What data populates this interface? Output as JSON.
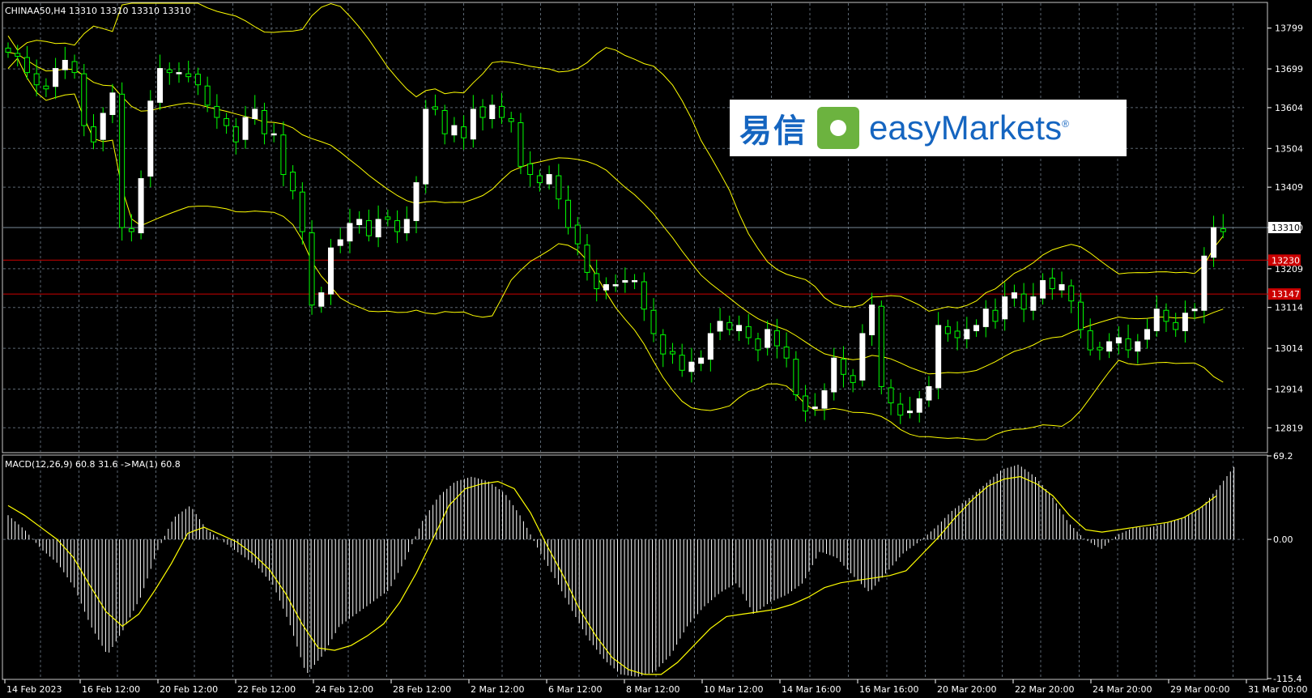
{
  "chart_data": [
    {
      "type": "candlestick",
      "title": "CHINAA50,H4  13310 13310 13310 13310",
      "ylim": [
        12760,
        13860
      ],
      "y_ticks": [
        13799,
        13699,
        13604,
        13504,
        13409,
        13310,
        13209,
        13114,
        13014,
        12914,
        12819
      ],
      "price_tags": [
        {
          "value": 13310,
          "label": "13310",
          "line_color": "#7a8a99",
          "tag_bg": "#ffffff",
          "tag_fg": "#000000"
        },
        {
          "value": 13230,
          "label": "13230",
          "line_color": "#cc0000",
          "tag_bg": "#cc0000",
          "tag_fg": "#ffffff"
        },
        {
          "value": 13147,
          "label": "13147",
          "line_color": "#cc0000",
          "tag_bg": "#cc0000",
          "tag_fg": "#ffffff"
        }
      ],
      "indicators": [
        "Bollinger Bands"
      ],
      "series": [
        {
          "name": "close",
          "values": [
            13740,
            13730,
            13690,
            13660,
            13650,
            13700,
            13720,
            13690,
            13560,
            13520,
            13590,
            13640,
            13310,
            13300,
            13430,
            13620,
            13700,
            13690,
            13690,
            13680,
            13660,
            13610,
            13580,
            13560,
            13520,
            13580,
            13600,
            13540,
            13540,
            13440,
            13400,
            13300,
            13120,
            13150,
            13260,
            13280,
            13320,
            13330,
            13290,
            13330,
            13330,
            13300,
            13330,
            13420,
            13600,
            13600,
            13540,
            13560,
            13530,
            13600,
            13580,
            13610,
            13580,
            13570,
            13460,
            13440,
            13420,
            13440,
            13380,
            13310,
            13270,
            13200,
            13160,
            13170,
            13170,
            13180,
            13180,
            13110,
            13050,
            13000,
            13000,
            12960,
            12980,
            12990,
            13050,
            13080,
            13060,
            13070,
            13040,
            13010,
            13060,
            13020,
            12990,
            12900,
            12860,
            12870,
            12910,
            12990,
            12950,
            12930,
            13050,
            13120,
            12920,
            12880,
            12850,
            12860,
            12890,
            12920,
            13070,
            13050,
            13040,
            13060,
            13070,
            13110,
            13080,
            13140,
            13150,
            13110,
            13140,
            13180,
            13160,
            13170,
            13130,
            13060,
            13010,
            13010,
            13030,
            13040,
            13010,
            13030,
            13060,
            13110,
            13080,
            13060,
            13100,
            13110,
            13240,
            13310,
            13300
          ],
          "color_up": "#ffffff",
          "color_down": "#00ff00"
        },
        {
          "name": "Bollinger Upper",
          "color": "#ffff00"
        },
        {
          "name": "Bollinger Middle",
          "color": "#ffff00"
        },
        {
          "name": "Bollinger Lower",
          "color": "#ffff00"
        }
      ]
    },
    {
      "type": "bar+line",
      "title": "MACD(12,26,9) 60.8 31.6  ->MA(1) 60.8",
      "ylim": [
        -115.4,
        69.2
      ],
      "y_ticks": [
        69.2,
        0.0,
        -115.4
      ],
      "y_tick_labels": [
        "69.2",
        "0.00",
        "-115.4"
      ],
      "series": [
        {
          "name": "MACD",
          "color": "#ffffff",
          "values": [
            20,
            8,
            -8,
            -20,
            -40,
            -72,
            -96,
            -74,
            -48,
            -10,
            18,
            28,
            8,
            -2,
            -12,
            -22,
            -38,
            -70,
            -112,
            -96,
            -72,
            -62,
            -52,
            -42,
            -16,
            15,
            36,
            48,
            52,
            48,
            38,
            18,
            -8,
            -32,
            -58,
            -82,
            -100,
            -112,
            -114,
            -110,
            -96,
            -72,
            -56,
            -44,
            -36,
            -62,
            -52,
            -46,
            -36,
            -10,
            -15,
            -30,
            -44,
            -28,
            -12,
            -2,
            10,
            24,
            34,
            46,
            58,
            62,
            52,
            36,
            14,
            0,
            -8,
            4,
            10,
            10,
            14,
            18,
            26,
            42,
            60
          ]
        },
        {
          "name": "Signal",
          "color": "#ffff00",
          "values": [
            28,
            20,
            10,
            0,
            -15,
            -38,
            -60,
            -72,
            -62,
            -42,
            -20,
            5,
            10,
            4,
            -2,
            -12,
            -25,
            -45,
            -70,
            -90,
            -92,
            -88,
            -80,
            -70,
            -52,
            -28,
            0,
            28,
            42,
            46,
            48,
            42,
            22,
            -5,
            -30,
            -58,
            -80,
            -98,
            -108,
            -112,
            -112,
            -102,
            -88,
            -74,
            -64,
            -62,
            -60,
            -58,
            -54,
            -48,
            -40,
            -36,
            -34,
            -32,
            -30,
            -26,
            -12,
            2,
            18,
            32,
            44,
            50,
            52,
            46,
            36,
            20,
            8,
            6,
            8,
            10,
            12,
            14,
            18,
            26,
            36
          ]
        }
      ]
    }
  ],
  "x_tick_labels": [
    "14 Feb 2023",
    "16 Feb 12:00",
    "20 Feb 12:00",
    "22 Feb 12:00",
    "24 Feb 12:00",
    "28 Feb 12:00",
    "2 Mar 12:00",
    "6 Mar 12:00",
    "8 Mar 12:00",
    "10 Mar 12:00",
    "14 Mar 16:00",
    "16 Mar 16:00",
    "20 Mar 20:00",
    "22 Mar 20:00",
    "24 Mar 20:00",
    "29 Mar 00:00",
    "31 Mar 00:00"
  ],
  "logo": {
    "cn": "易信",
    "en": "easyMarkets",
    "registered": "®"
  },
  "colors": {
    "background": "#000000",
    "grid": "#5a6570",
    "axis": "#ffffff",
    "bull": "#ffffff",
    "bear": "#00ff00",
    "band": "#ffff00"
  }
}
